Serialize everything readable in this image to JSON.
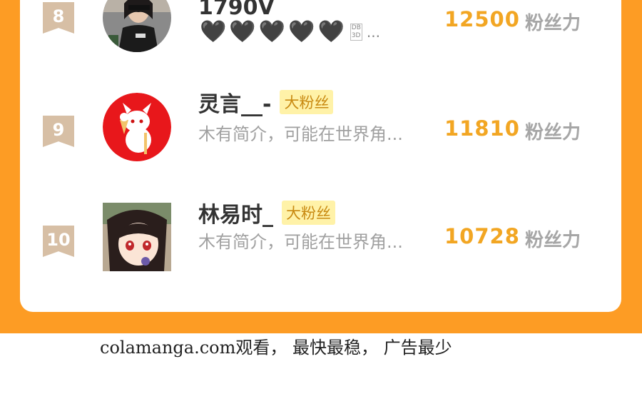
{
  "ranking": [
    {
      "rank": "8",
      "name": "1790V",
      "badge": "",
      "bio_type": "hearts",
      "hearts": [
        "🖤",
        "🖤",
        "🖤",
        "🖤",
        "🖤"
      ],
      "tag_top": "DB",
      "tag_bottom": "3D",
      "more": "...",
      "score": "12500",
      "unit": "粉丝力"
    },
    {
      "rank": "9",
      "name": "灵言__-",
      "badge": "大粉丝",
      "bio": "木有简介，可能在世界角...",
      "score": "11810",
      "unit": "粉丝力"
    },
    {
      "rank": "10",
      "name": "林易时_",
      "badge": "大粉丝",
      "bio": "木有简介，可能在世界角...",
      "score": "10728",
      "unit": "粉丝力"
    }
  ],
  "footer": "colamanga.com观看， 最快最稳， 广告最少",
  "colors": {
    "background": "#fd9c24",
    "score": "#f2a623",
    "badge_bg": "#fff2a8",
    "rank_badge": "#d7bfa5"
  }
}
